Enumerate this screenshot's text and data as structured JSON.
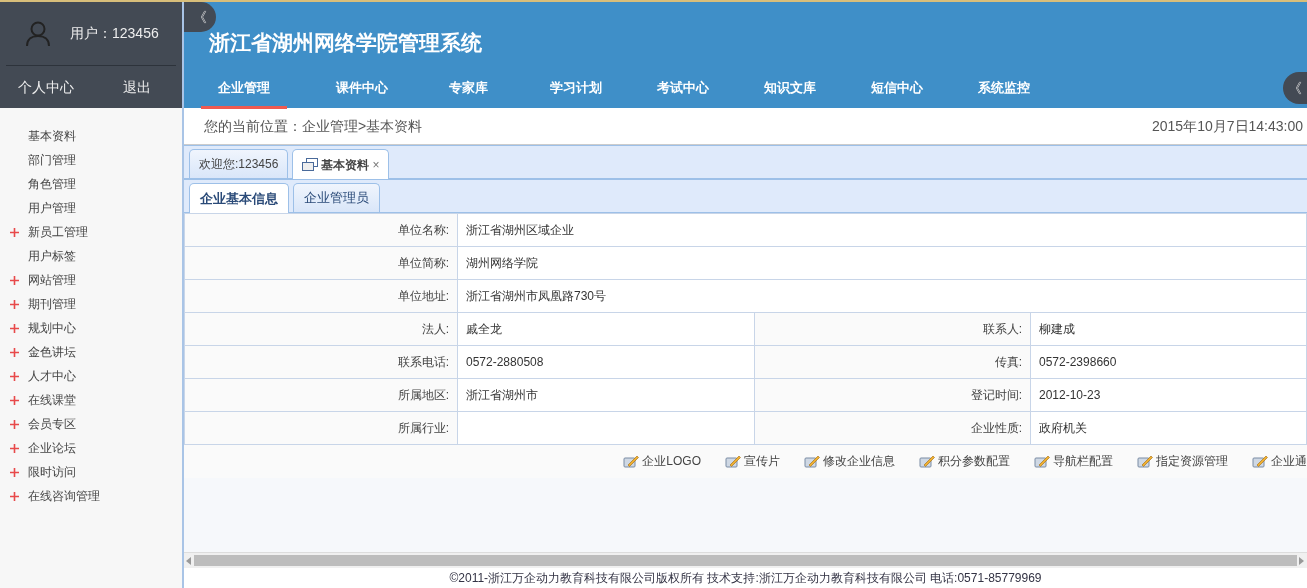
{
  "sidebar": {
    "user_label": "用户：123456",
    "links": [
      "个人中心",
      "退出"
    ],
    "collapse_glyph": "《",
    "items": [
      {
        "label": "基本资料",
        "expandable": false
      },
      {
        "label": "部门管理",
        "expandable": false
      },
      {
        "label": "角色管理",
        "expandable": false
      },
      {
        "label": "用户管理",
        "expandable": false
      },
      {
        "label": "新员工管理",
        "expandable": true
      },
      {
        "label": "用户标签",
        "expandable": false
      },
      {
        "label": "网站管理",
        "expandable": true
      },
      {
        "label": "期刊管理",
        "expandable": true
      },
      {
        "label": "规划中心",
        "expandable": true
      },
      {
        "label": "金色讲坛",
        "expandable": true
      },
      {
        "label": "人才中心",
        "expandable": true
      },
      {
        "label": "在线课堂",
        "expandable": true
      },
      {
        "label": "会员专区",
        "expandable": true
      },
      {
        "label": "企业论坛",
        "expandable": true
      },
      {
        "label": "限时访问",
        "expandable": true
      },
      {
        "label": "在线咨询管理",
        "expandable": true
      }
    ]
  },
  "header": {
    "title": "浙江省湖州网络学院管理系统",
    "expand_glyph": "《",
    "nav": [
      {
        "label": "企业管理",
        "selected": true
      },
      {
        "label": "课件中心",
        "selected": false
      },
      {
        "label": "专家库",
        "selected": false
      },
      {
        "label": "学习计划",
        "selected": false
      },
      {
        "label": "考试中心",
        "selected": false
      },
      {
        "label": "知识文库",
        "selected": false
      },
      {
        "label": "短信中心",
        "selected": false
      },
      {
        "label": "系统监控",
        "selected": false
      }
    ]
  },
  "breadcrumb": "您的当前位置：企业管理>基本资料",
  "datetime": "2015年10月7日14:43:00",
  "page_tabs": [
    {
      "label": "欢迎您:123456",
      "selected": false,
      "has_icon": false
    },
    {
      "label": "基本资料",
      "selected": true,
      "has_icon": true,
      "close": "×"
    }
  ],
  "sub_tabs": [
    {
      "label": "企业基本信息",
      "selected": true
    },
    {
      "label": "企业管理员",
      "selected": false
    }
  ],
  "form_rows": [
    {
      "fields": [
        {
          "label": "单位名称:",
          "value": "浙江省湖州区域企业"
        }
      ]
    },
    {
      "fields": [
        {
          "label": "单位简称:",
          "value": "湖州网络学院"
        }
      ]
    },
    {
      "fields": [
        {
          "label": "单位地址:",
          "value": "浙江省湖州市凤凰路730号"
        }
      ]
    },
    {
      "fields": [
        {
          "label": "法人:",
          "value": "戚全龙"
        },
        {
          "label": "联系人:",
          "value": "柳建成"
        }
      ]
    },
    {
      "fields": [
        {
          "label": "联系电话:",
          "value": "0572-2880508"
        },
        {
          "label": "传真:",
          "value": "0572-2398660"
        }
      ]
    },
    {
      "fields": [
        {
          "label": "所属地区:",
          "value": "浙江省湖州市"
        },
        {
          "label": "登记时间:",
          "value": "2012-10-23"
        }
      ]
    },
    {
      "fields": [
        {
          "label": "所属行业:"
        },
        {
          "label": "企业性质:",
          "value": "政府机关"
        }
      ]
    }
  ],
  "actions": [
    "企业LOGO",
    "宣传片",
    "修改企业信息",
    "积分参数配置",
    "导航栏配置",
    "指定资源管理",
    "企业通"
  ],
  "footer": "©2011-浙江万企动力教育科技有限公司版权所有 技术支持:浙江万企动力教育科技有限公司 电话:0571-85779969"
}
